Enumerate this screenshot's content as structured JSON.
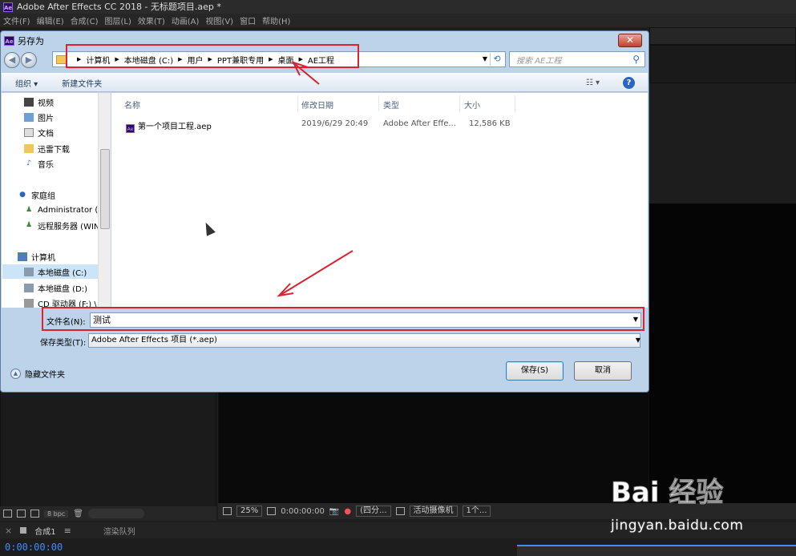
{
  "app": {
    "title": "Adobe After Effects CC 2018 - 无标题项目.aep *",
    "logo": "Ae",
    "menu": [
      "文件(F)",
      "编辑(E)",
      "合成(C)",
      "图层(L)",
      "效果(T)",
      "动画(A)",
      "视图(V)",
      "窗口",
      "帮助(H)"
    ]
  },
  "dialog": {
    "title": "另存为",
    "close_label": "✕",
    "breadcrumb": [
      "计算机",
      "本地磁盘 (C:)",
      "用户",
      "PPT兼职专用",
      "桌面",
      "AE工程"
    ],
    "search_placeholder": "搜索 AE工程",
    "toolbar": {
      "organize": "组织 ▾",
      "new_folder": "新建文件夹"
    },
    "nav": [
      {
        "label": "视频",
        "icon": "video-icon"
      },
      {
        "label": "图片",
        "icon": "picture-icon"
      },
      {
        "label": "文档",
        "icon": "document-icon"
      },
      {
        "label": "迅雷下载",
        "icon": "download-icon"
      },
      {
        "label": "音乐",
        "icon": "music-icon"
      },
      {
        "label": "家庭组",
        "icon": "homegroup-icon"
      },
      {
        "label": "Administrator (V",
        "icon": "user-icon"
      },
      {
        "label": "远程服务器 (WIN",
        "icon": "user-icon"
      },
      {
        "label": "计算机",
        "icon": "computer-icon"
      },
      {
        "label": "本地磁盘 (C:)",
        "icon": "drive-icon"
      },
      {
        "label": "本地磁盘 (D:)",
        "icon": "drive-icon"
      },
      {
        "label": "CD 驱动器 (F:) \\",
        "icon": "cd-icon"
      }
    ],
    "columns": [
      "名称",
      "修改日期",
      "类型",
      "大小"
    ],
    "files": [
      {
        "name": "第一个项目工程.aep",
        "date": "2019/6/29 20:49",
        "type": "Adobe After Effe...",
        "size": "12,586 KB"
      }
    ],
    "filename_label": "文件名(N):",
    "filename_value": "测试",
    "savetype_label": "保存类型(T):",
    "savetype_value": "Adobe After Effects 项目 (*.aep)",
    "hide_folders": "隐藏文件夹",
    "save_button": "保存(S)",
    "cancel_button": "取消"
  },
  "ae_bottom": {
    "bpc": "8 bpc",
    "zoom": "25%",
    "timecode_small": "0:00:00:00",
    "resolution": "(四分...",
    "camera": "活动摄像机",
    "views": "1个...",
    "comp_tab": "合成1",
    "render_tab": "渲染队列",
    "timecode": "0:00:00:00"
  },
  "watermark": {
    "brand": "Bai 经验",
    "url": "jingyan.baidu.com"
  },
  "colors": {
    "annotation_red": "#d9232f",
    "ae_blue": "#3f8cff",
    "dialog_frame": "#bcd3ea"
  }
}
